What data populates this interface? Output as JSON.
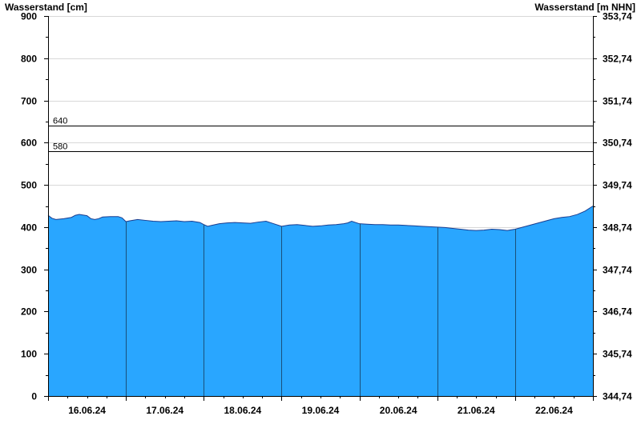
{
  "chart_data": {
    "type": "area",
    "y_left_label": "Wasserstand [cm]",
    "y_right_label": "Wasserstand [m NHN]",
    "y_left_ticks": [
      0,
      100,
      200,
      300,
      400,
      500,
      600,
      700,
      800,
      900
    ],
    "y_right_ticks": [
      "344,74",
      "345,74",
      "346,74",
      "347,74",
      "348,74",
      "349,74",
      "350,74",
      "351,74",
      "352,74",
      "353,74"
    ],
    "ylim": [
      0,
      900
    ],
    "x_days": [
      "16.06.24",
      "17.06.24",
      "18.06.24",
      "19.06.24",
      "20.06.24",
      "21.06.24",
      "22.06.24"
    ],
    "thresholds": [
      {
        "label": "640",
        "value": 640
      },
      {
        "label": "580",
        "value": 580
      }
    ],
    "fill_color": "#29a6ff",
    "line_color": "#1a3d8f",
    "grid": true,
    "series": [
      {
        "x": [
          0.0,
          0.05,
          0.1,
          0.2,
          0.3,
          0.35,
          0.4,
          0.5,
          0.55,
          0.6,
          0.65,
          0.7,
          0.8,
          0.9,
          0.95,
          1.0,
          1.05,
          1.15,
          1.25,
          1.35,
          1.45,
          1.55,
          1.65,
          1.75,
          1.85,
          1.95,
          2.0,
          2.05,
          2.1,
          2.2,
          2.3,
          2.4,
          2.5,
          2.6,
          2.7,
          2.8,
          2.9,
          3.0,
          3.1,
          3.2,
          3.3,
          3.4,
          3.5,
          3.6,
          3.7,
          3.8,
          3.85,
          3.9,
          4.0,
          4.1,
          4.2,
          4.3,
          4.4,
          4.5,
          4.6,
          4.7,
          4.8,
          4.9,
          5.0,
          5.1,
          5.2,
          5.3,
          5.4,
          5.5,
          5.6,
          5.7,
          5.8,
          5.9,
          6.0,
          6.1,
          6.2,
          6.3,
          6.4,
          6.5,
          6.6,
          6.7,
          6.8,
          6.9,
          7.0
        ],
        "values": [
          428,
          421,
          418,
          420,
          423,
          428,
          430,
          427,
          420,
          418,
          420,
          424,
          425,
          425,
          422,
          413,
          415,
          418,
          416,
          414,
          413,
          414,
          415,
          413,
          414,
          411,
          406,
          402,
          404,
          408,
          410,
          411,
          410,
          409,
          412,
          414,
          408,
          402,
          405,
          406,
          404,
          402,
          403,
          405,
          406,
          408,
          410,
          414,
          408,
          407,
          406,
          406,
          405,
          405,
          404,
          403,
          402,
          401,
          400,
          399,
          397,
          395,
          393,
          392,
          393,
          395,
          394,
          392,
          395,
          400,
          405,
          410,
          415,
          420,
          423,
          425,
          430,
          438,
          450
        ]
      }
    ]
  }
}
